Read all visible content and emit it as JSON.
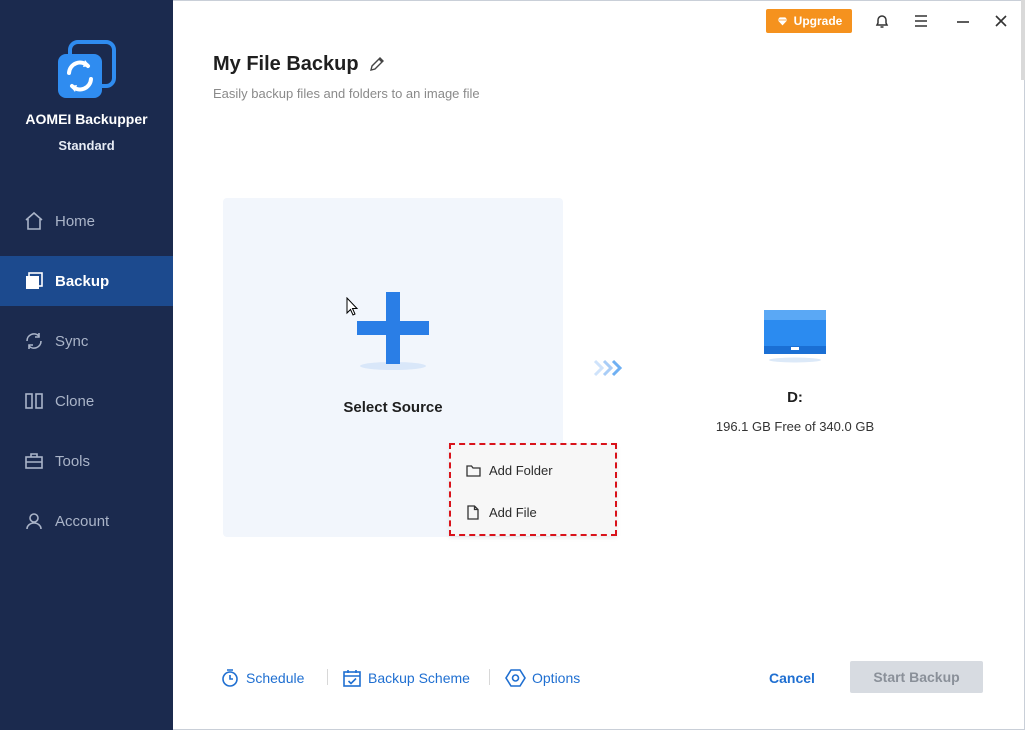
{
  "app": {
    "name": "AOMEI Backupper",
    "edition": "Standard"
  },
  "sidebar": {
    "items": [
      {
        "label": "Home",
        "icon": "home-icon",
        "active": false
      },
      {
        "label": "Backup",
        "icon": "backup-icon",
        "active": true
      },
      {
        "label": "Sync",
        "icon": "sync-icon",
        "active": false
      },
      {
        "label": "Clone",
        "icon": "clone-icon",
        "active": false
      },
      {
        "label": "Tools",
        "icon": "tools-icon",
        "active": false
      },
      {
        "label": "Account",
        "icon": "account-icon",
        "active": false
      }
    ]
  },
  "titlebar": {
    "upgrade_label": "Upgrade"
  },
  "header": {
    "title": "My File Backup",
    "subtitle": "Easily backup files and folders to an image file"
  },
  "source": {
    "label": "Select Source",
    "menu": [
      {
        "label": "Add Folder",
        "icon": "folder-icon"
      },
      {
        "label": "Add File",
        "icon": "file-icon"
      }
    ]
  },
  "destination": {
    "name": "D:",
    "free": "196.1 GB Free of 340.0 GB"
  },
  "footer": {
    "schedule": "Schedule",
    "scheme": "Backup Scheme",
    "options": "Options",
    "cancel": "Cancel",
    "start": "Start Backup"
  },
  "colors": {
    "sidebar_bg": "#1b2a4e",
    "sidebar_active": "#1c4a8e",
    "accent_blue": "#2a7ee6",
    "link_blue": "#1f6fd1",
    "upgrade_orange": "#f5921e",
    "highlight_red": "#d9131b",
    "disabled_button": "#d7dbe1"
  }
}
